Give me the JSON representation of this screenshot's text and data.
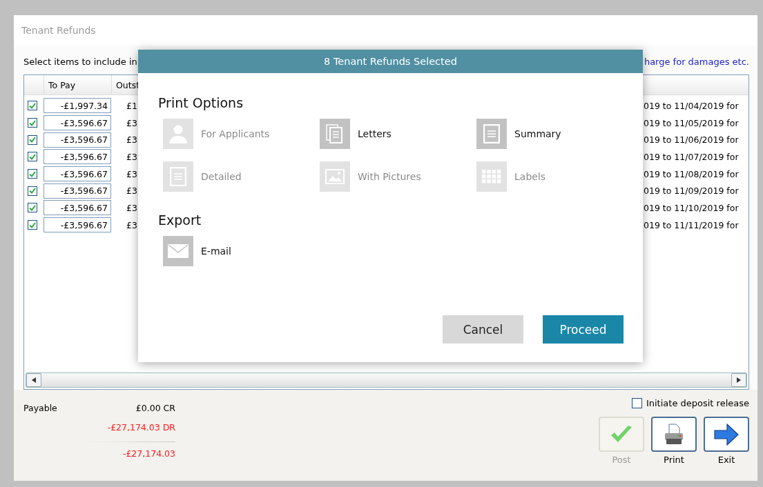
{
  "window": {
    "title": "Tenant Refunds"
  },
  "instruction": "Select items to include in",
  "damages_link": "harge for damages etc.",
  "table": {
    "columns": [
      "To Pay",
      "Outst"
    ],
    "rows": [
      {
        "checked": true,
        "to_pay": "-£1,997.34",
        "outstanding": "£1",
        "description": "019 to 11/04/2019 for"
      },
      {
        "checked": true,
        "to_pay": "-£3,596.67",
        "outstanding": "£3",
        "description": "019 to 11/05/2019 for"
      },
      {
        "checked": true,
        "to_pay": "-£3,596.67",
        "outstanding": "£3",
        "description": "019 to 11/06/2019 for"
      },
      {
        "checked": true,
        "to_pay": "-£3,596.67",
        "outstanding": "£3",
        "description": "019 to 11/07/2019 for"
      },
      {
        "checked": true,
        "to_pay": "-£3,596.67",
        "outstanding": "£3",
        "description": "019 to 11/08/2019 for"
      },
      {
        "checked": true,
        "to_pay": "-£3,596.67",
        "outstanding": "£3",
        "description": "019 to 11/09/2019 for"
      },
      {
        "checked": true,
        "to_pay": "-£3,596.67",
        "outstanding": "£3",
        "description": "019 to 11/10/2019 for"
      },
      {
        "checked": true,
        "to_pay": "-£3,596.67",
        "outstanding": "£3",
        "description": "019 to 11/11/2019 for"
      }
    ]
  },
  "totals": {
    "payable_label": "Payable",
    "lines": [
      {
        "value": "£0.00 CR",
        "negative": false
      },
      {
        "value": "-£27,174.03 DR",
        "negative": true
      },
      {
        "value": "-£27,174.03",
        "negative": true
      }
    ]
  },
  "deposit_release": {
    "label": "Initiate deposit release",
    "checked": false
  },
  "buttons": [
    {
      "label": "Post",
      "kind": "post",
      "disabled": true
    },
    {
      "label": "Print",
      "kind": "print",
      "disabled": false
    },
    {
      "label": "Exit",
      "kind": "exit",
      "disabled": false
    }
  ],
  "dialog": {
    "title": "8 Tenant Refunds Selected",
    "sections": [
      {
        "heading": "Print Options",
        "options": [
          {
            "label": "For Applicants",
            "kind": "person",
            "disabled": true
          },
          {
            "label": "Letters",
            "kind": "pages",
            "disabled": false
          },
          {
            "label": "Summary",
            "kind": "document",
            "disabled": false
          },
          {
            "label": "Detailed",
            "kind": "document",
            "disabled": true
          },
          {
            "label": "With Pictures",
            "kind": "image",
            "disabled": true
          },
          {
            "label": "Labels",
            "kind": "grid",
            "disabled": true
          }
        ]
      },
      {
        "heading": "Export",
        "options": [
          {
            "label": "E-mail",
            "kind": "mail",
            "disabled": false
          }
        ]
      }
    ],
    "cancel": "Cancel",
    "proceed": "Proceed"
  }
}
